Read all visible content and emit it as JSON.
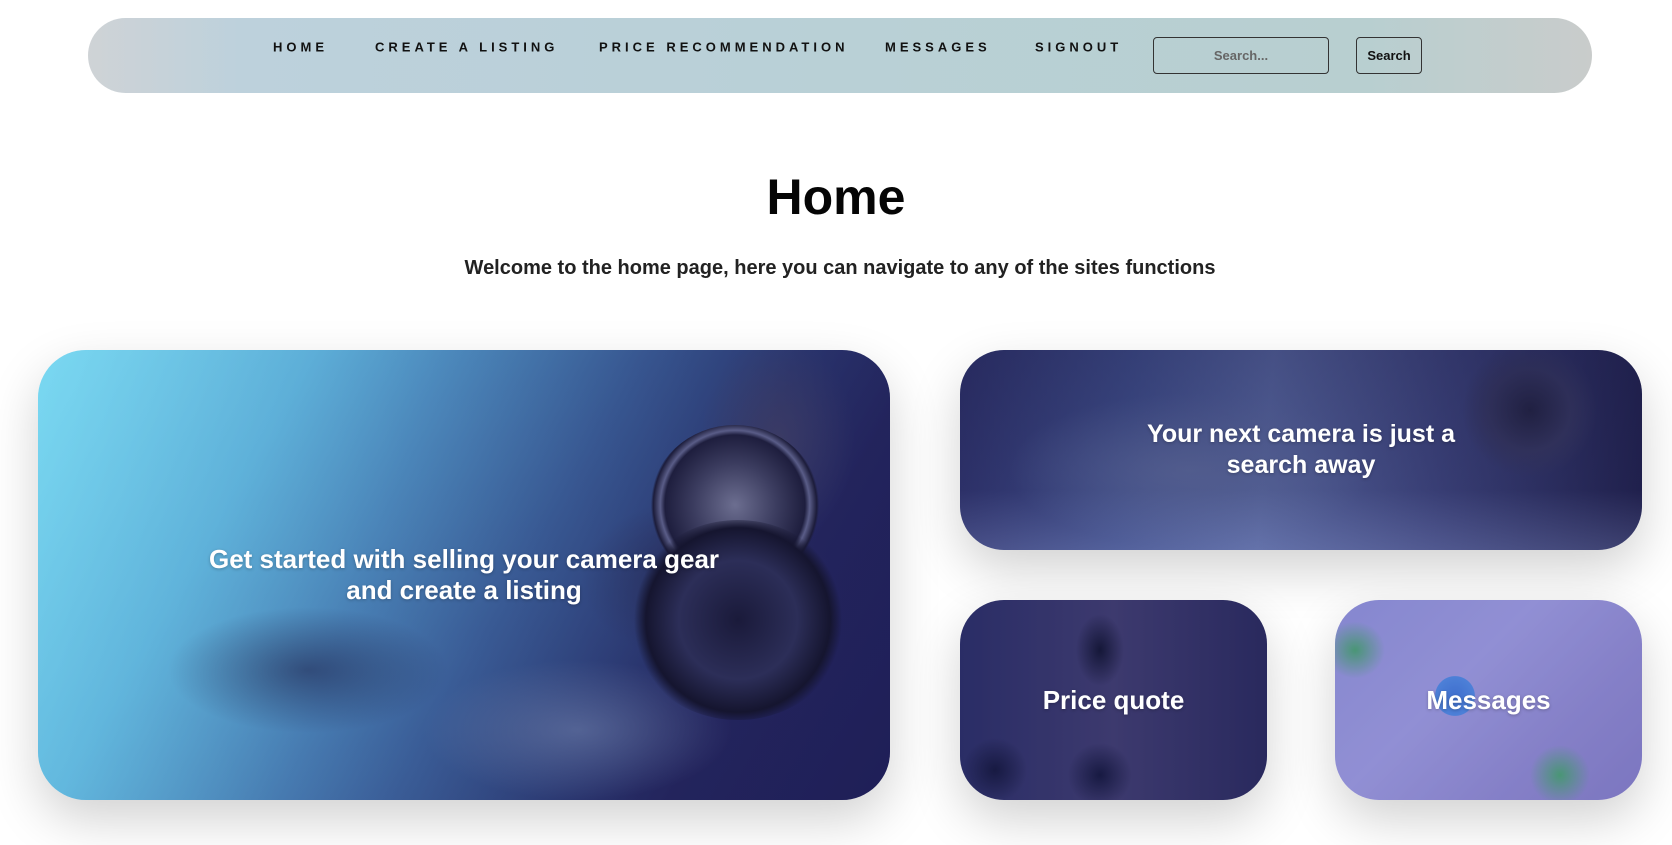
{
  "nav": {
    "links": [
      "HOME",
      "CREATE A LISTING",
      "PRICE RECOMMENDATION",
      "MESSAGES",
      "SIGNOUT"
    ],
    "search_placeholder": "Search...",
    "search_button": "Search"
  },
  "main": {
    "title": "Home",
    "subtitle": "Welcome to the home page, here you can navigate to any of the sites functions"
  },
  "cards": {
    "sell": "Get started with selling your camera gear and create a listing",
    "search": "Your next camera is just a search away",
    "price": "Price quote",
    "messages": "Messages"
  }
}
